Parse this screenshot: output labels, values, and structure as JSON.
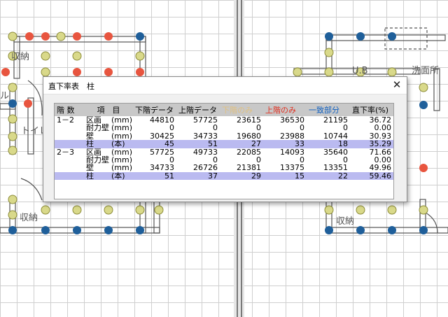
{
  "cad": {
    "labels": {
      "shuno_left_top": "収納",
      "toilet": "トイレ",
      "shuno_left_bottom": "収納",
      "ub": "U.B",
      "senmenjo": "洗面所",
      "shuno_right_bottom": "収納",
      "small_left": "ル"
    }
  },
  "dialog": {
    "title": "直下率表　柱",
    "close_glyph": "✕",
    "headers": [
      "階 数",
      "項　目",
      "下階データ",
      "上階データ",
      "下階のみ",
      "上階のみ",
      "一致部分",
      "直下率(%)"
    ],
    "header_colors": {
      "lower_only": "#e0c080",
      "upper_only": "#e03020",
      "match": "#1060c0"
    },
    "rows": [
      {
        "floor": "1－2",
        "item": "区画",
        "unit": "(mm)",
        "lower": "44810",
        "upper": "57725",
        "lower_only": "23615",
        "upper_only": "36530",
        "match": "21195",
        "rate": "36.72",
        "highlight": false
      },
      {
        "floor": "",
        "item": "耐力壁",
        "unit": "(mm)",
        "lower": "0",
        "upper": "0",
        "lower_only": "0",
        "upper_only": "0",
        "match": "0",
        "rate": "0.00",
        "highlight": false
      },
      {
        "floor": "",
        "item": "壁",
        "unit": "(mm)",
        "lower": "30425",
        "upper": "34733",
        "lower_only": "19680",
        "upper_only": "23988",
        "match": "10744",
        "rate": "30.93",
        "highlight": false
      },
      {
        "floor": "",
        "item": "柱",
        "unit": "(本)",
        "lower": "45",
        "upper": "51",
        "lower_only": "27",
        "upper_only": "33",
        "match": "18",
        "rate": "35.29",
        "highlight": true
      },
      {
        "floor": "2－3",
        "item": "区画",
        "unit": "(mm)",
        "lower": "57725",
        "upper": "49733",
        "lower_only": "22085",
        "upper_only": "14093",
        "match": "35640",
        "rate": "71.66",
        "highlight": false
      },
      {
        "floor": "",
        "item": "耐力壁",
        "unit": "(mm)",
        "lower": "0",
        "upper": "0",
        "lower_only": "0",
        "upper_only": "0",
        "match": "0",
        "rate": "0.00",
        "highlight": false
      },
      {
        "floor": "",
        "item": "壁",
        "unit": "(mm)",
        "lower": "34733",
        "upper": "26726",
        "lower_only": "21381",
        "upper_only": "13375",
        "match": "13351",
        "rate": "49.96",
        "highlight": false
      },
      {
        "floor": "",
        "item": "柱",
        "unit": "(本)",
        "lower": "51",
        "upper": "37",
        "lower_only": "29",
        "upper_only": "15",
        "match": "22",
        "rate": "59.46",
        "highlight": true
      }
    ]
  }
}
